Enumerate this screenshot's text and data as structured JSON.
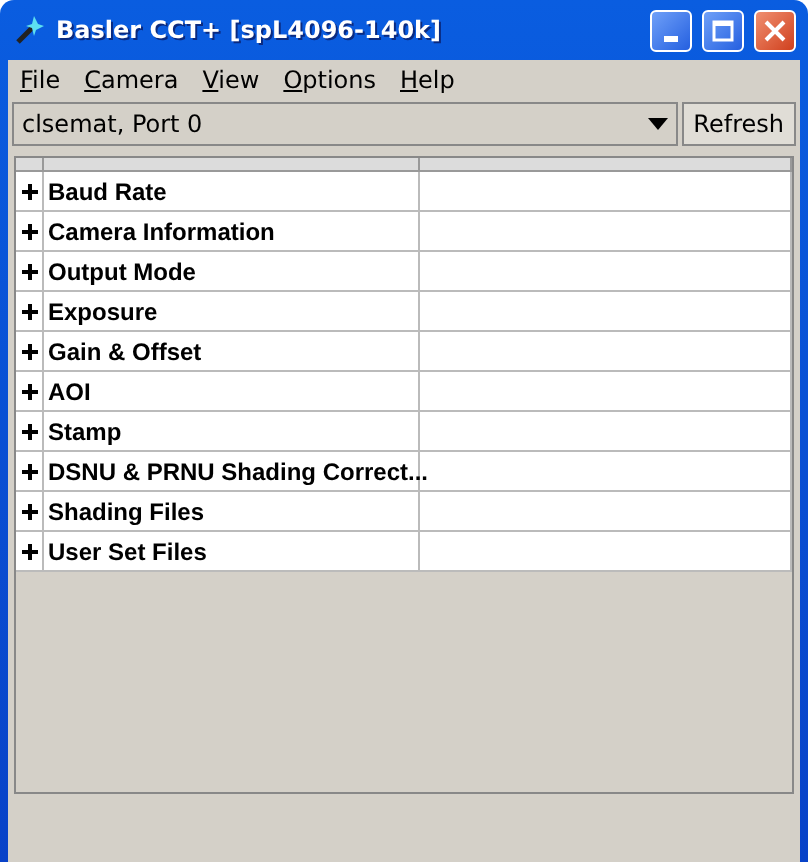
{
  "window": {
    "title": "Basler CCT+ [spL4096-140k]"
  },
  "menu": [
    {
      "label": "File"
    },
    {
      "label": "Camera"
    },
    {
      "label": "View"
    },
    {
      "label": "Options"
    },
    {
      "label": "Help"
    }
  ],
  "port_select": {
    "value": "clsemat, Port 0"
  },
  "refresh_button": {
    "label": "Refresh"
  },
  "tree": [
    {
      "label": "Baud Rate",
      "expanded": false
    },
    {
      "label": "Camera Information",
      "expanded": false
    },
    {
      "label": "Output Mode",
      "expanded": false
    },
    {
      "label": "Exposure",
      "expanded": false
    },
    {
      "label": "Gain & Offset",
      "expanded": false
    },
    {
      "label": "AOI",
      "expanded": false
    },
    {
      "label": "Stamp",
      "expanded": false
    },
    {
      "label": "DSNU & PRNU Shading Correct...",
      "expanded": false
    },
    {
      "label": "Shading Files",
      "expanded": false
    },
    {
      "label": "User Set Files",
      "expanded": false
    }
  ]
}
